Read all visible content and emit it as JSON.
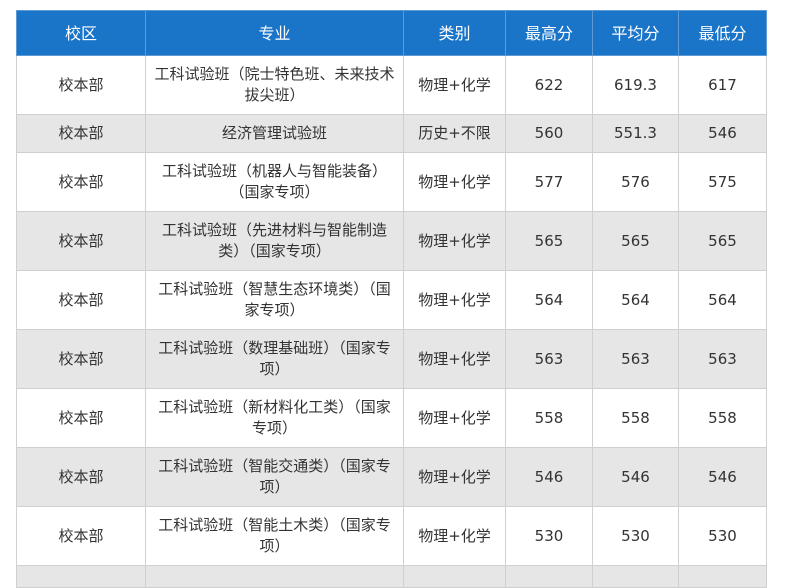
{
  "table": {
    "headers": [
      "校区",
      "专业",
      "类别",
      "最高分",
      "平均分",
      "最低分"
    ],
    "rows": [
      {
        "campus": "校本部",
        "major": "工科试验班（院士特色班、未来技术拔尖班）",
        "category": "物理+化学",
        "max": "622",
        "avg": "619.3",
        "min": "617"
      },
      {
        "campus": "校本部",
        "major": "经济管理试验班",
        "category": "历史+不限",
        "max": "560",
        "avg": "551.3",
        "min": "546"
      },
      {
        "campus": "校本部",
        "major": "工科试验班（机器人与智能装备）（国家专项）",
        "category": "物理+化学",
        "max": "577",
        "avg": "576",
        "min": "575"
      },
      {
        "campus": "校本部",
        "major": "工科试验班（先进材料与智能制造类）（国家专项）",
        "category": "物理+化学",
        "max": "565",
        "avg": "565",
        "min": "565"
      },
      {
        "campus": "校本部",
        "major": "工科试验班（智慧生态环境类）（国家专项）",
        "category": "物理+化学",
        "max": "564",
        "avg": "564",
        "min": "564"
      },
      {
        "campus": "校本部",
        "major": "工科试验班（数理基础班）（国家专项）",
        "category": "物理+化学",
        "max": "563",
        "avg": "563",
        "min": "563"
      },
      {
        "campus": "校本部",
        "major": "工科试验班（新材料化工类）（国家专项）",
        "category": "物理+化学",
        "max": "558",
        "avg": "558",
        "min": "558"
      },
      {
        "campus": "校本部",
        "major": "工科试验班（智能交通类）（国家专项）",
        "category": "物理+化学",
        "max": "546",
        "avg": "546",
        "min": "546"
      },
      {
        "campus": "校本部",
        "major": "工科试验班（智能土木类）（国家专项）",
        "category": "物理+化学",
        "max": "530",
        "avg": "530",
        "min": "530"
      }
    ]
  }
}
